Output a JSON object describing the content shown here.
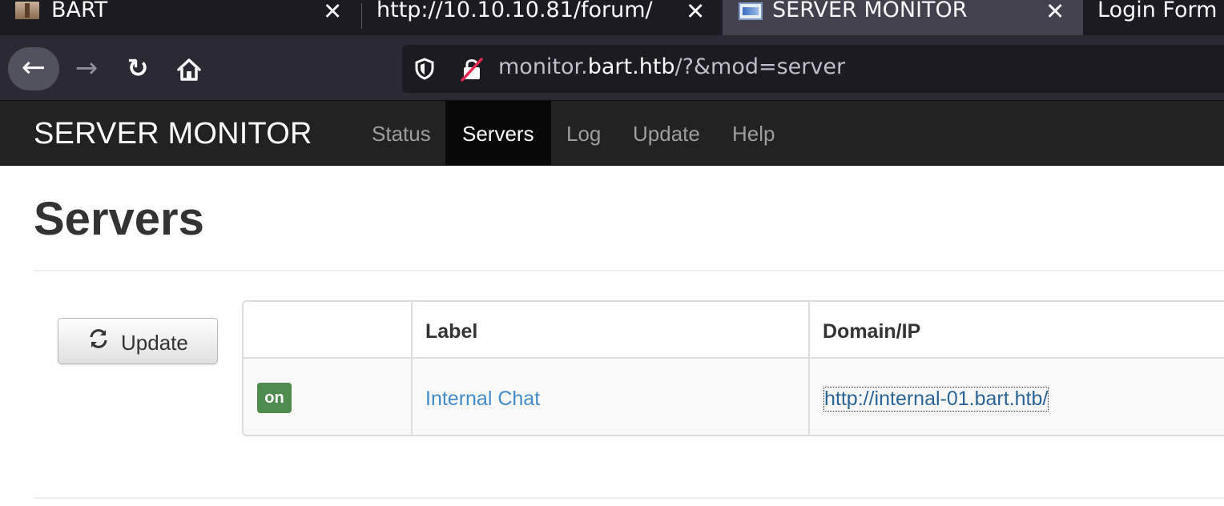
{
  "browser": {
    "tabs": [
      {
        "title": "BART",
        "active": false
      },
      {
        "title": "http://10.10.10.81/forum/",
        "active": false
      },
      {
        "title": "SERVER MONITOR",
        "active": true
      },
      {
        "title": "Login Form",
        "active": false
      }
    ],
    "close_glyph": "✕",
    "url": {
      "prefix": "monitor.",
      "host": "bart.htb",
      "path": "/?&mod=server"
    },
    "icons": [
      "back-arrow-icon",
      "forward-arrow-icon",
      "reload-icon",
      "home-icon",
      "shield-icon",
      "insecure-lock-icon"
    ]
  },
  "app": {
    "brand": "SERVER MONITOR",
    "menu": [
      {
        "label": "Status",
        "active": false
      },
      {
        "label": "Servers",
        "active": true
      },
      {
        "label": "Log",
        "active": false
      },
      {
        "label": "Update",
        "active": false
      },
      {
        "label": "Help",
        "active": false
      }
    ]
  },
  "page": {
    "title": "Servers",
    "update_button": "Update",
    "table": {
      "headers": [
        "",
        "Label",
        "Domain/IP"
      ],
      "rows": [
        {
          "status": "on",
          "label": "Internal Chat",
          "domain": "http://internal-01.bart.htb/"
        }
      ]
    }
  },
  "colors": {
    "navbar": "#222222",
    "status_on": "#4f8a4f",
    "link": "#428bca"
  }
}
